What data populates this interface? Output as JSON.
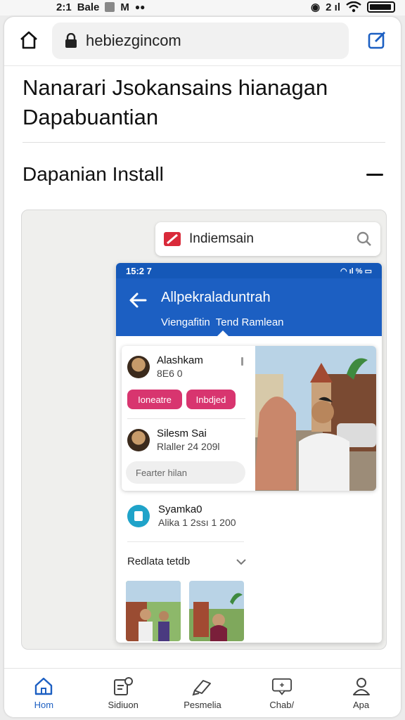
{
  "status_bar": {
    "time": "2:1",
    "carrier_text": "Bale",
    "extra_text": "M",
    "right_text": "2 ıl"
  },
  "browser": {
    "url": "hebiezgincom",
    "home_icon": "home-icon",
    "lock_icon": "lock-icon",
    "edit_icon": "edit-icon"
  },
  "page": {
    "title": "Nanarari Jsokansains hianagan Dapabuantian",
    "section_title": "Dapanian Install",
    "collapse_icon": "minus-icon"
  },
  "preview": {
    "search_text": "Indiemsain",
    "phone": {
      "time": "15:2 7",
      "title": "Allpekraladuntrah",
      "tabs": [
        "Viengafitin",
        "Tend Ramlean"
      ],
      "feed": {
        "item1_name": "Alashkam",
        "item1_sub": "8E6 0",
        "button1": "Ioneatre",
        "button2": "Inbdjed",
        "item2_name": "Silesm Sai",
        "item2_sub": "Rlaller 24 209l",
        "input_placeholder": "Fearter hilan"
      },
      "list_item_name": "Syamka0",
      "list_item_sub": "Alika 1 2ssı 1 200",
      "recent_label": "Redlata tetdb"
    }
  },
  "bottom_nav": [
    {
      "label": "Hom",
      "icon": "home-icon",
      "active": true
    },
    {
      "label": "Sidiuon",
      "icon": "notes-icon",
      "active": false
    },
    {
      "label": "Pesmelia",
      "icon": "tag-icon",
      "active": false
    },
    {
      "label": "Chab/",
      "icon": "chat-icon",
      "active": false
    },
    {
      "label": "Apa",
      "icon": "profile-icon",
      "active": false
    }
  ],
  "colors": {
    "accent": "#1c5fc2",
    "pink": "#d8356f",
    "brand_red": "#d92a3a",
    "app_teal": "#1fa3c9"
  }
}
